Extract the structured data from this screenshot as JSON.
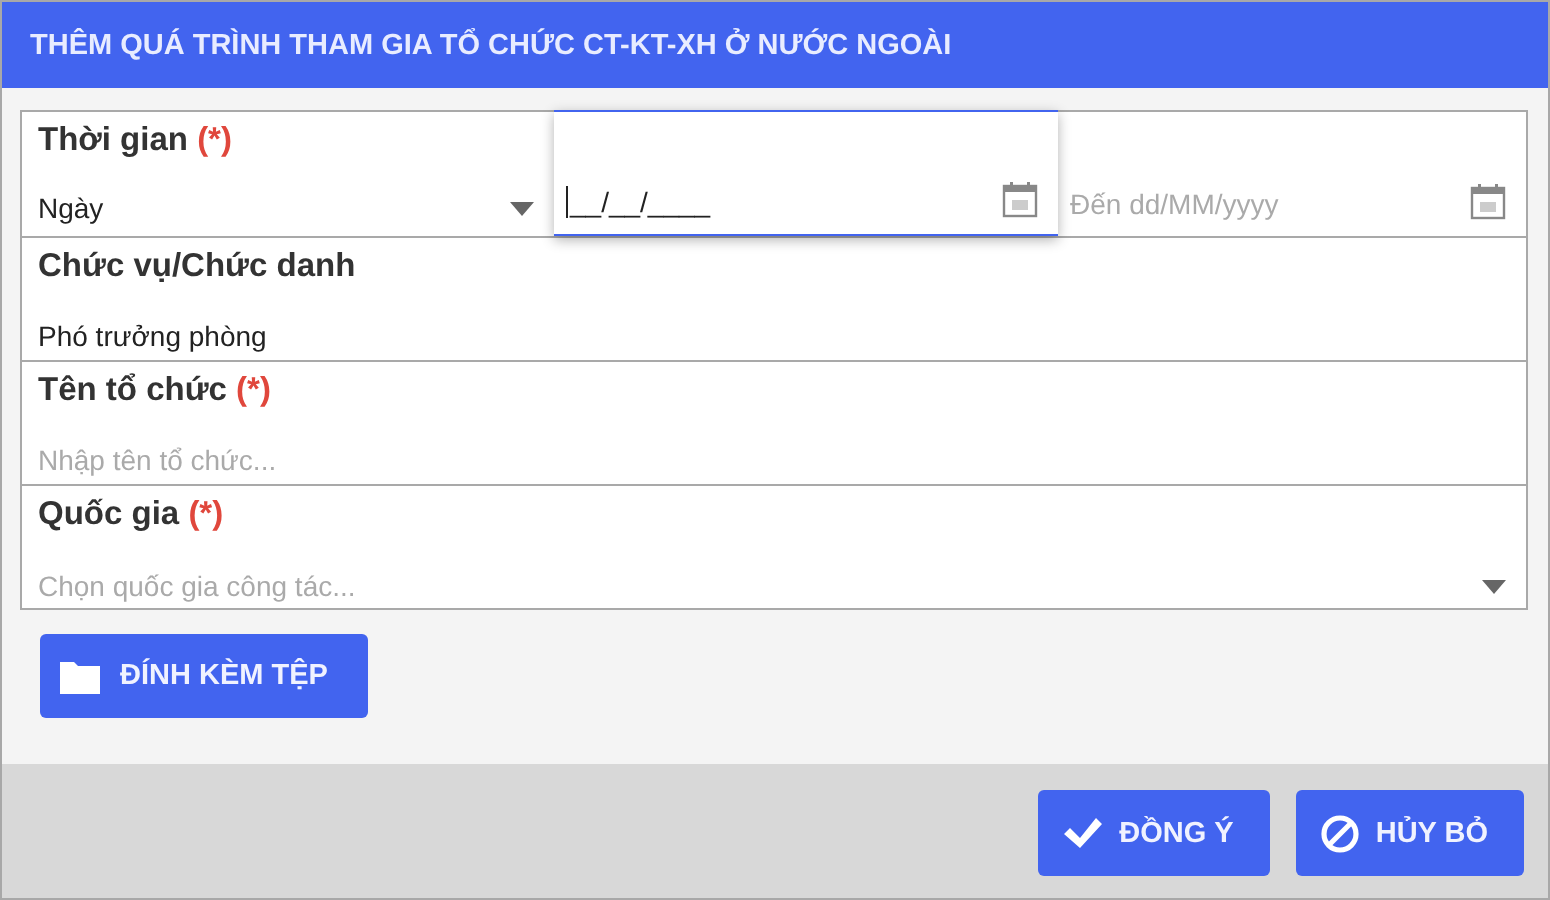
{
  "dialog": {
    "title": "THÊM QUÁ TRÌNH THAM GIA TỔ CHỨC CT-KT-XH Ở NƯỚC NGOÀI"
  },
  "time_row": {
    "label": "Thời gian",
    "required_mark": "(*)",
    "unit_select": {
      "value": "Ngày"
    },
    "from_date": {
      "value": "__/__/____",
      "focused": true
    },
    "to_date": {
      "placeholder": "Đến dd/MM/yyyy",
      "focused": false
    }
  },
  "fields": [
    {
      "label": "Chức vụ/Chức danh",
      "value": "Phó trưởng phòng",
      "kind": "text"
    },
    {
      "label": "Tên tổ chức",
      "required_mark": "(*)",
      "placeholder": "Nhập tên tổ chức...",
      "kind": "text"
    },
    {
      "label": "Quốc gia",
      "required_mark": "(*)",
      "placeholder": "Chọn quốc gia công tác...",
      "kind": "select"
    }
  ],
  "attach_button": "ĐÍNH KÈM TỆP",
  "footer_buttons": [
    {
      "label": "ĐỒNG Ý",
      "kind": "confirm"
    },
    {
      "label": "HỦY BỎ",
      "kind": "cancel"
    }
  ]
}
